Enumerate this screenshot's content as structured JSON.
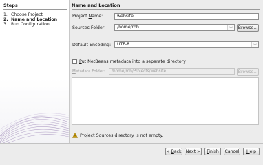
{
  "steps": {
    "title": "Steps",
    "items": [
      {
        "num": "1.",
        "label": "Choose Project",
        "active": false
      },
      {
        "num": "2.",
        "label": "Name and Location",
        "active": true
      },
      {
        "num": "3.",
        "label": "Run Configuration",
        "active": false
      }
    ]
  },
  "section": {
    "title": "Name and Location"
  },
  "form": {
    "project_name": {
      "label_pre": "Project ",
      "label_key": "N",
      "label_post": "ame:",
      "value": "website"
    },
    "sources_folder": {
      "label_pre": "",
      "label_key": "S",
      "label_post": "ources Folder:",
      "value": "/home/rob"
    },
    "browse_button": {
      "pre": "",
      "key": "B",
      "post": "rowse..."
    },
    "default_encoding": {
      "label_pre": "",
      "label_key": "D",
      "label_post": "efault Encoding:",
      "value": "UTF-8"
    },
    "netbeans_metadata": {
      "pre": "",
      "key": "P",
      "post": "ut NetBeans metadata into a separate directory",
      "checked": false
    },
    "metadata_folder": {
      "label_pre": "",
      "label_key": "M",
      "label_post": "etadata Folder:",
      "value": "/home/rob/Projects/website"
    },
    "metadata_browse": {
      "label": "Browse..."
    }
  },
  "status": {
    "warning": "Project Sources directory is not empty."
  },
  "buttons": {
    "back": {
      "pre": "< ",
      "key": "B",
      "post": "ack"
    },
    "next": {
      "label": "Next >"
    },
    "finish": {
      "pre": "",
      "key": "F",
      "post": "inish"
    },
    "cancel": {
      "label": "Cancel"
    },
    "help": {
      "pre": "",
      "key": "H",
      "post": "elp"
    }
  },
  "colors": {
    "warning": "#e8b100",
    "decor": "#7c5d9e"
  }
}
